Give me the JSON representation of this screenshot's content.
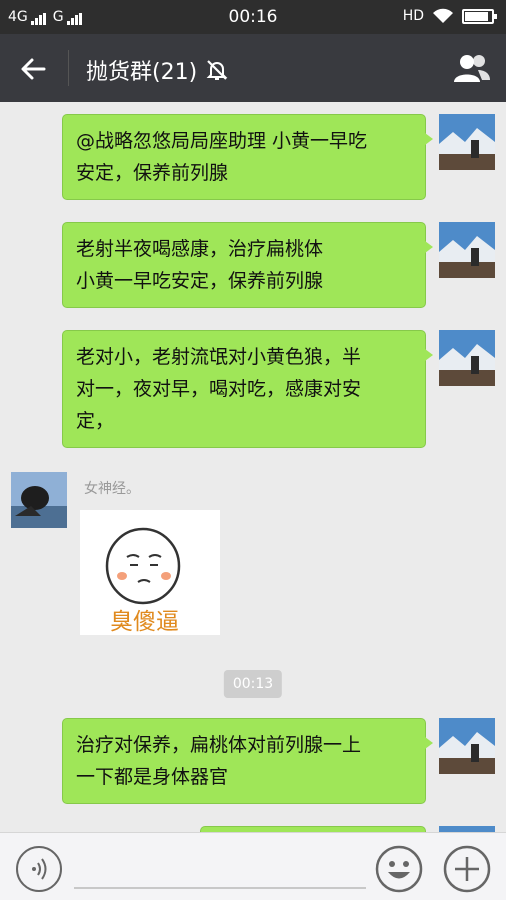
{
  "status_bar": {
    "signal_1": "4G",
    "signal_2": "G",
    "time": "00:16",
    "hd": "HD",
    "battery_level": 0.9
  },
  "header": {
    "title": "抛货群(21)",
    "back_icon": "arrow-left-icon",
    "mute_icon": "bell-off-icon",
    "members_icon": "group-members-icon"
  },
  "messages": [
    {
      "side": "right",
      "lines": [
        "@战略忽悠局局座助理 小黄一早吃",
        "安定，保养前列腺"
      ]
    },
    {
      "side": "right",
      "lines": [
        "老射半夜喝感康，治疗扁桃体",
        "小黄一早吃安定，保养前列腺"
      ]
    },
    {
      "side": "right",
      "lines": [
        "老对小，老射流氓对小黄色狼，半",
        "对一，夜对早，喝对吃，感康对安",
        "定，"
      ]
    },
    {
      "side": "left",
      "nickname": "女神经。",
      "sticker_caption": "臭傻逼"
    },
    {
      "timestamp": "00:13"
    },
    {
      "side": "right",
      "lines": [
        "治疗对保养，扁桃体对前列腺一上",
        "一下都是身体器官"
      ]
    }
  ],
  "input_bar": {
    "voice_icon": "voice-icon",
    "emoji_icon": "emoji-icon",
    "plus_icon": "plus-icon",
    "input_value": ""
  },
  "colors": {
    "bubble_green": "#9fe658",
    "header_bg": "#393a3f",
    "chat_bg": "#ebebeb"
  }
}
